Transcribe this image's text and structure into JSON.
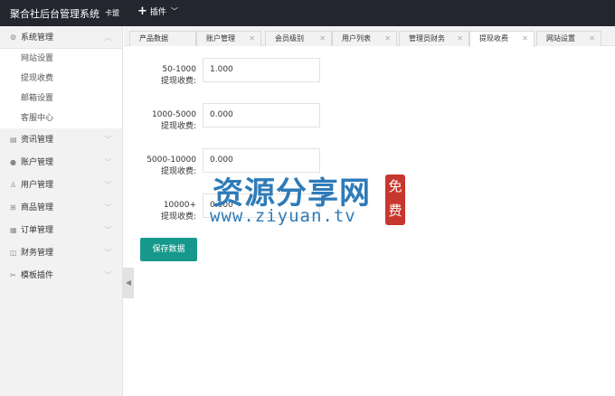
{
  "header": {
    "brand": "聚合社后台管理系统",
    "brand_sub": "卡盟",
    "plugin_menu": "插件",
    "plugin_icon": "plus-icon"
  },
  "sidebar": {
    "groups": [
      {
        "label": "系统管理",
        "icon": "gear-icon",
        "open": true
      },
      {
        "label": "资讯管理",
        "icon": "news-icon",
        "open": false
      },
      {
        "label": "账户管理",
        "icon": "user-icon",
        "open": false
      },
      {
        "label": "用户管理",
        "icon": "users-icon",
        "open": false
      },
      {
        "label": "商品管理",
        "icon": "cart-icon",
        "open": false
      },
      {
        "label": "订单管理",
        "icon": "order-icon",
        "open": false
      },
      {
        "label": "财务管理",
        "icon": "finance-icon",
        "open": false
      },
      {
        "label": "模板插件",
        "icon": "tools-icon",
        "open": false
      }
    ],
    "sub_items": [
      "网站设置",
      "提现收费",
      "邮箱设置",
      "客服中心"
    ]
  },
  "tabs": [
    {
      "label": "产品数据",
      "closable": false,
      "active": false
    },
    {
      "label": "账户管理",
      "closable": true,
      "active": false
    },
    {
      "label": "会员级别",
      "closable": true,
      "active": false
    },
    {
      "label": "用户列表",
      "closable": true,
      "active": false
    },
    {
      "label": "管理员财务",
      "closable": true,
      "active": false
    },
    {
      "label": "提现收费",
      "closable": true,
      "active": true
    },
    {
      "label": "网站设置",
      "closable": true,
      "active": false
    }
  ],
  "form": {
    "rows": [
      {
        "range": "50-1000",
        "suffix": "提现收费:",
        "value": "1.000"
      },
      {
        "range": "1000-5000",
        "suffix": "提现收费:",
        "value": "0.000"
      },
      {
        "range": "5000-10000",
        "suffix": "提现收费:",
        "value": "0.000"
      },
      {
        "range": "10000+",
        "suffix": "提现收费:",
        "value": "0.000"
      }
    ],
    "save_label": "保存数据"
  },
  "watermark": {
    "cn": "资源分享网",
    "url": "www.ziyuan.tv",
    "stamp": "免费"
  },
  "colors": {
    "topbar": "#23262e",
    "sidebar": "#f2f2f2",
    "accent": "#16998c",
    "watermark": "#2e7bb8",
    "stamp": "#c8372d"
  }
}
